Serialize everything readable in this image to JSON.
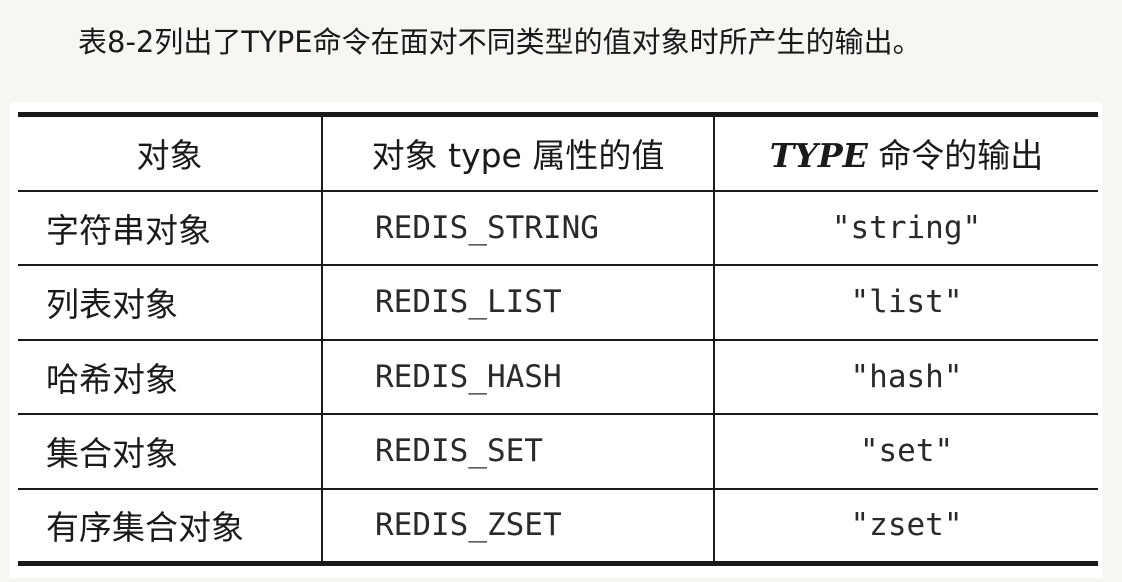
{
  "caption": "表8-2列出了TYPE命令在面对不同类型的值对象时所产生的输出。",
  "table": {
    "headers": {
      "object": "对象",
      "type_attr": "对象 type 属性的值",
      "type_cmd_em": "TYPE",
      "type_cmd_rest": " 命令的输出"
    },
    "rows": [
      {
        "object": "字符串对象",
        "type_value": "REDIS_STRING",
        "output": "\"string\""
      },
      {
        "object": "列表对象",
        "type_value": "REDIS_LIST",
        "output": "\"list\""
      },
      {
        "object": "哈希对象",
        "type_value": "REDIS_HASH",
        "output": "\"hash\""
      },
      {
        "object": "集合对象",
        "type_value": "REDIS_SET",
        "output": "\"set\""
      },
      {
        "object": "有序集合对象",
        "type_value": "REDIS_ZSET",
        "output": "\"zset\""
      }
    ]
  }
}
